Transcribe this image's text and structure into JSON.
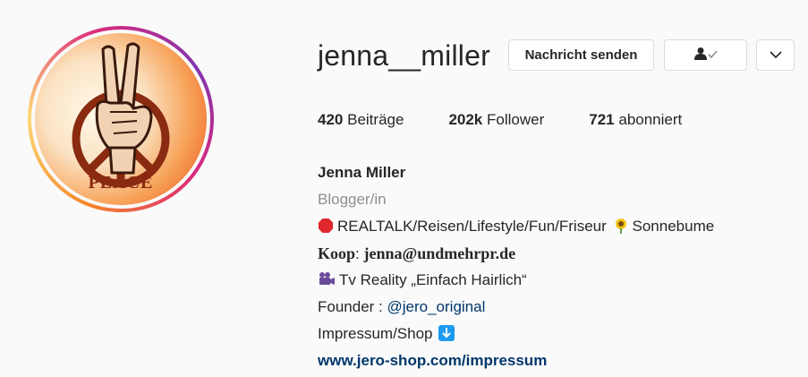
{
  "profile": {
    "username": "jenna__miller",
    "avatar_text": "PEACE",
    "buttons": {
      "message": "Nachricht senden",
      "follow_icon": "person-check-icon",
      "more_icon": "chevron-down-icon"
    },
    "stats": {
      "posts_count": "420",
      "posts_label": "Beiträge",
      "followers_count": "202k",
      "followers_label": "Follower",
      "following_count": "721",
      "following_label": "abonniert"
    },
    "bio": {
      "full_name": "Jenna Miller",
      "category": "Blogger/in",
      "line1_text": "REALTALK/Reisen/Lifestyle/Fun/Friseur",
      "line1_suffix": "Sonnebume",
      "koop_label": "Koop",
      "koop_sep": ": ",
      "koop_email": "jenna@undmehrpr.de",
      "tv_text": "Tv Reality „Einfach Hairlich“",
      "founder_label": "Founder : ",
      "founder_mention": "@jero_original",
      "impressum_text": "Impressum/Shop",
      "website": "www.jero-shop.com/impressum"
    },
    "colors": {
      "link": "#00376b",
      "muted": "#8e8e8e",
      "text": "#262626"
    }
  }
}
